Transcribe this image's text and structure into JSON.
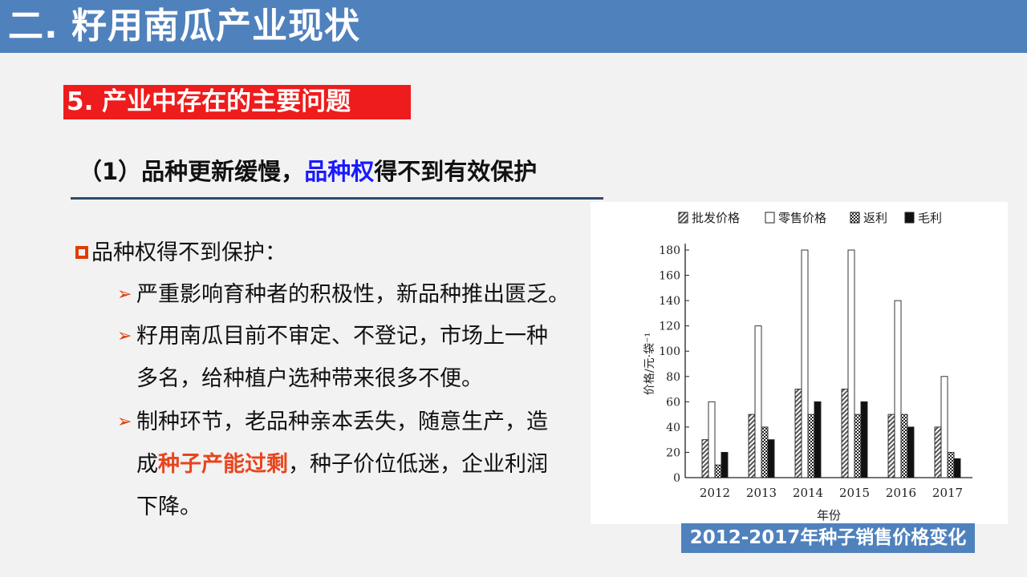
{
  "header": {
    "title": "二. 籽用南瓜产业现状"
  },
  "section": {
    "label": "5. 产业中存在的主要问题"
  },
  "subheading": {
    "prefix": "（1）品种更新缓慢，",
    "highlight": "品种权",
    "suffix": "得不到有效保护"
  },
  "bullets": {
    "main": "品种权得不到保护：",
    "items": [
      {
        "arrow": "➢",
        "line1": " 严重影响育种者的积极性，新品种推出匮乏。"
      },
      {
        "arrow": "➢",
        "line1": "籽用南瓜目前不审定、不登记，市场上一种",
        "line2": "多名，给种植户选种带来很多不便。"
      },
      {
        "arrow": "➢",
        "line1": "制种环节，老品种亲本丢失，随意生产，造",
        "line2_pre": "成",
        "line2_hl": "种子产能过剩",
        "line2_post": "，种子价位低迷，企业利润",
        "line3": "下降。"
      }
    ]
  },
  "caption": "2012-2017年种子销售价格变化",
  "colors": {
    "title_bar": "#4f81bd",
    "section_label": "#ee1c1c",
    "highlight_blue": "#1a1aff",
    "highlight_red": "#e8451e",
    "bullet": "#e03c00"
  },
  "chart_data": {
    "type": "bar",
    "categories": [
      "2012",
      "2013",
      "2014",
      "2015",
      "2016",
      "2017"
    ],
    "series": [
      {
        "name": "批发价格",
        "pattern": "hatched",
        "values": [
          30,
          50,
          70,
          70,
          50,
          40
        ]
      },
      {
        "name": "零售价格",
        "pattern": "white",
        "values": [
          60,
          120,
          180,
          180,
          140,
          80
        ]
      },
      {
        "name": "返利",
        "pattern": "checkered",
        "values": [
          10,
          40,
          50,
          50,
          50,
          20
        ]
      },
      {
        "name": "毛利",
        "pattern": "black",
        "values": [
          20,
          30,
          60,
          60,
          40,
          15
        ]
      }
    ],
    "xlabel": "年份",
    "ylabel": "价格/元·袋⁻¹",
    "ylim": [
      0,
      180
    ],
    "yticks": [
      0,
      20,
      40,
      60,
      80,
      100,
      120,
      140,
      160,
      180
    ],
    "legend": "top",
    "grid": false
  }
}
